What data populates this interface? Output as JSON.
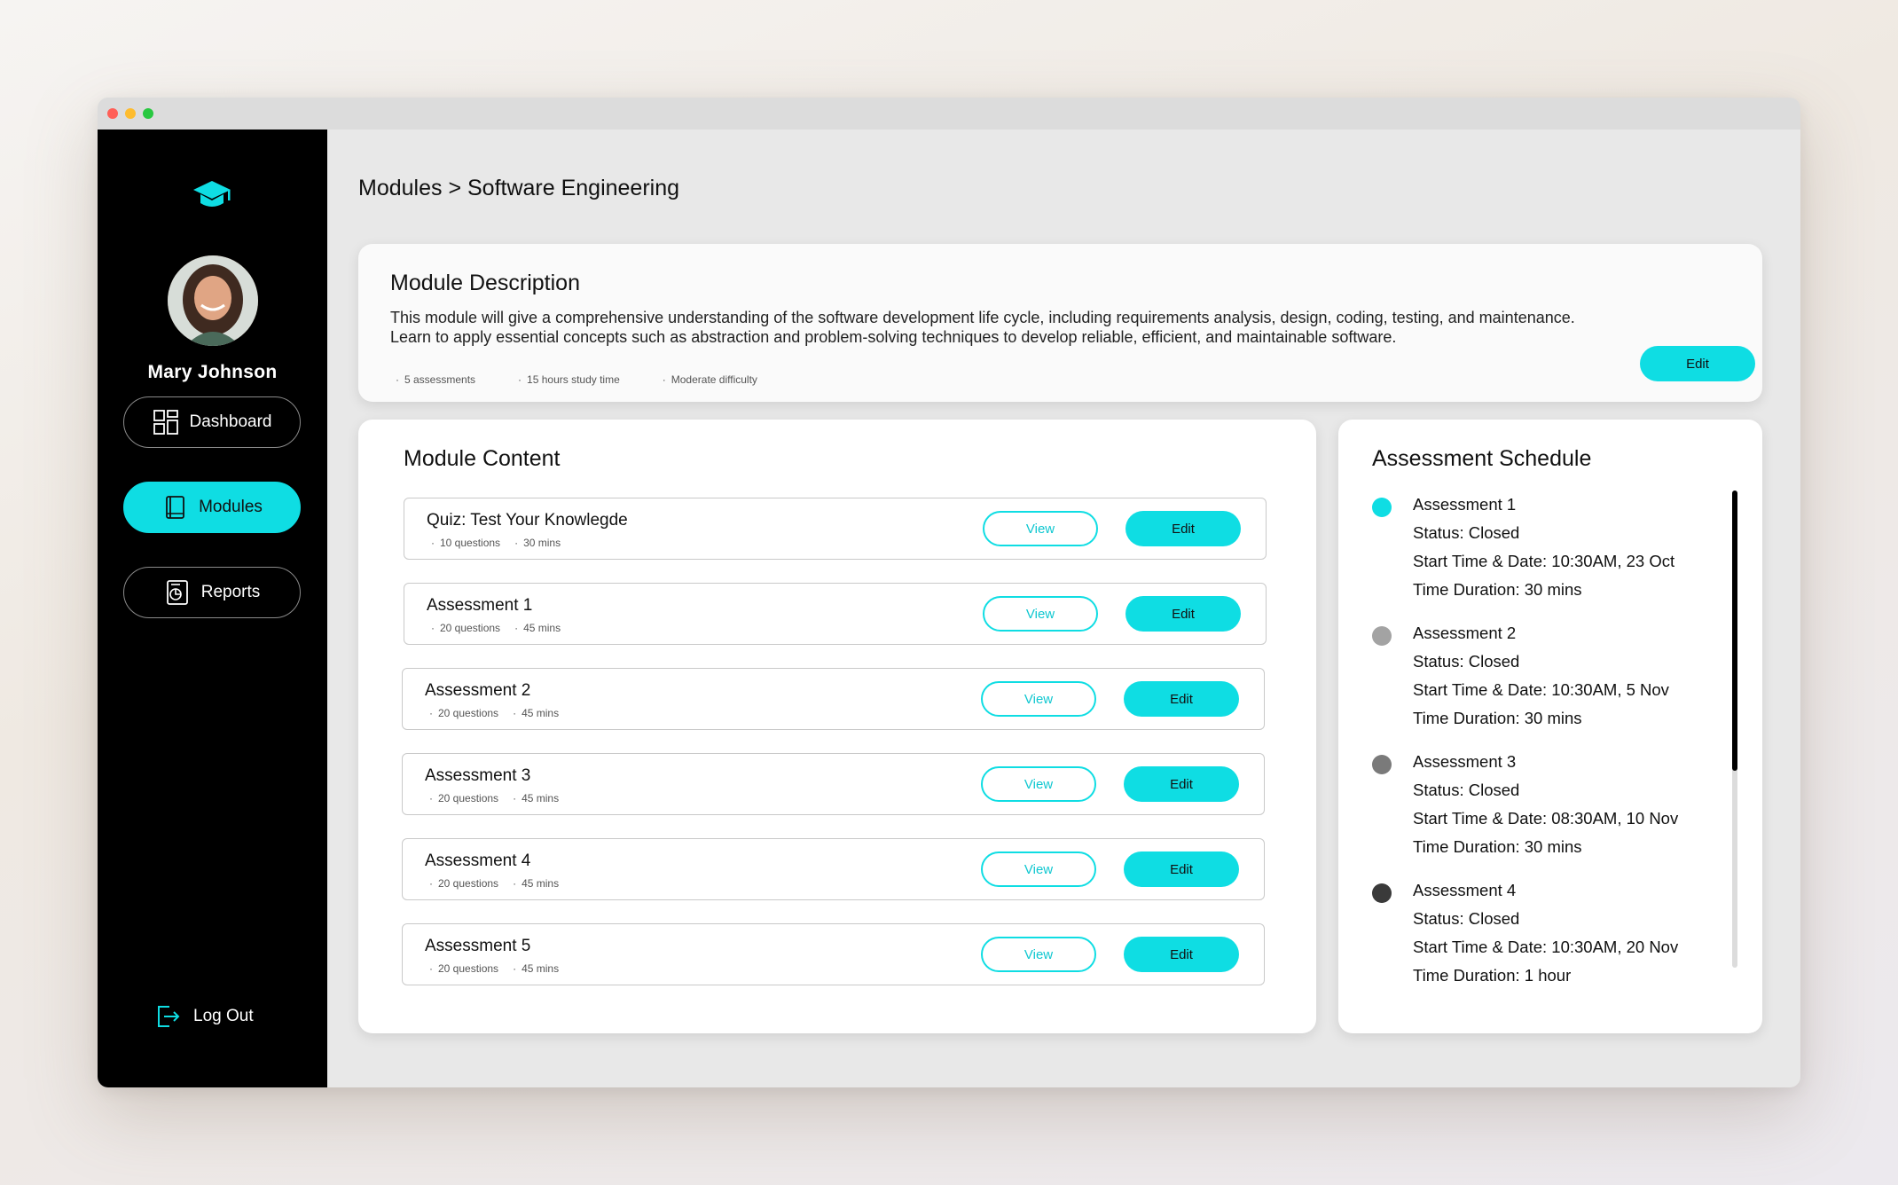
{
  "user": {
    "name": "Mary Johnson"
  },
  "nav": {
    "items": [
      {
        "label": "Dashboard",
        "icon": "dashboard-icon"
      },
      {
        "label": "Modules",
        "icon": "book-icon",
        "active": true
      },
      {
        "label": "Reports",
        "icon": "report-icon"
      }
    ],
    "logout": "Log Out"
  },
  "breadcrumb": "Modules > Software Engineering",
  "description": {
    "title": "Module Description",
    "text": "This module will give a comprehensive understanding of the software development life cycle, including requirements analysis, design, coding, testing, and maintenance. Learn to apply essential concepts such as abstraction and problem-solving techniques to develop reliable, efficient, and maintainable software.",
    "meta": [
      "5 assessments",
      "15 hours study time",
      "Moderate difficulty"
    ],
    "edit_label": "Edit"
  },
  "content": {
    "title": "Module Content",
    "view_label": "View",
    "edit_label": "Edit",
    "items": [
      {
        "title": "Quiz: Test Your Knowlegde",
        "questions": "10 questions",
        "duration": "30 mins"
      },
      {
        "title": "Assessment 1",
        "questions": "20 questions",
        "duration": "45 mins"
      },
      {
        "title": "Assessment 2",
        "questions": "20 questions",
        "duration": "45 mins"
      },
      {
        "title": "Assessment 3",
        "questions": "20 questions",
        "duration": "45 mins"
      },
      {
        "title": "Assessment 4",
        "questions": "20 questions",
        "duration": "45 mins"
      },
      {
        "title": "Assessment 5",
        "questions": "20 questions",
        "duration": "45 mins"
      }
    ]
  },
  "schedule": {
    "title": "Assessment Schedule",
    "items": [
      {
        "name": "Assessment 1",
        "status": "Status: Closed",
        "start": "Start Time & Date: 10:30AM, 23 Oct",
        "duration": "Time Duration: 30 mins",
        "color": "#0fdde3"
      },
      {
        "name": "Assessment 2",
        "status": "Status: Closed",
        "start": "Start Time & Date: 10:30AM, 5 Nov",
        "duration": "Time Duration: 30 mins",
        "color": "#a3a3a3"
      },
      {
        "name": "Assessment 3",
        "status": "Status: Closed",
        "start": "Start Time & Date: 08:30AM, 10 Nov",
        "duration": "Time Duration: 30 mins",
        "color": "#7a7a7a"
      },
      {
        "name": "Assessment 4",
        "status": "Status: Closed",
        "start": "Start Time & Date: 10:30AM, 20 Nov",
        "duration": "Time Duration: 1 hour",
        "color": "#3a3a3a"
      }
    ]
  },
  "colors": {
    "accent": "#0fdde3",
    "sidebar": "#000000",
    "background": "#e8e8e8"
  }
}
